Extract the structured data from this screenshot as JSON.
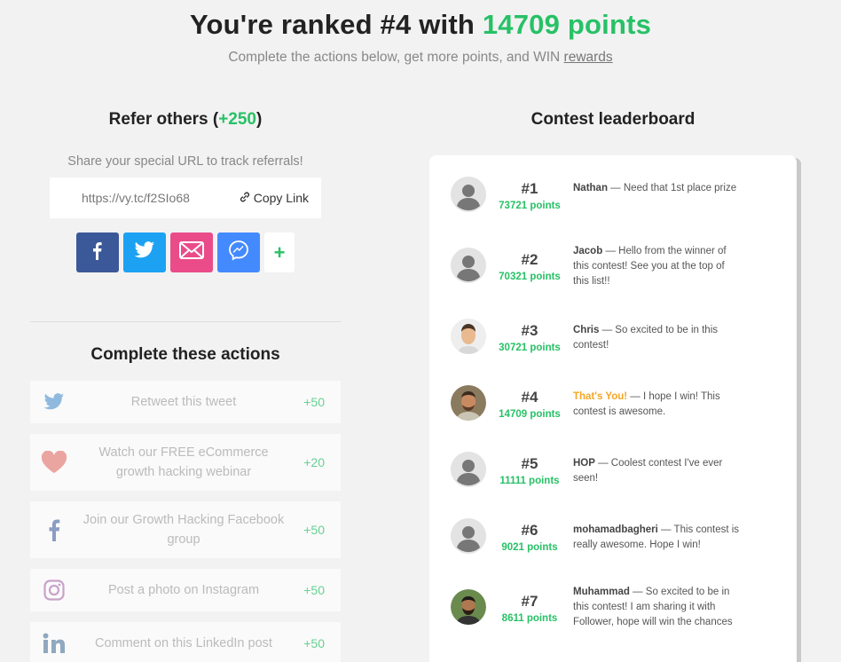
{
  "hero": {
    "title_prefix": "You're ranked #4 with ",
    "title_points": "14709 points",
    "subtitle_prefix": "Complete the actions below, get more points, and WIN ",
    "subtitle_link": "rewards"
  },
  "refer": {
    "title": "Refer others (",
    "bonus": "+250",
    "title_suffix": ")",
    "share_text": "Share your special URL to track referrals!",
    "url": "https://vy.tc/f2SIo68",
    "copy_label": "Copy Link",
    "share_buttons": [
      {
        "name": "facebook",
        "color": "#3b5998",
        "icon": "facebook-icon"
      },
      {
        "name": "twitter",
        "color": "#1da1f2",
        "icon": "twitter-icon"
      },
      {
        "name": "email",
        "color": "#ea4c89",
        "icon": "mail-icon"
      },
      {
        "name": "messenger",
        "color": "#448aff",
        "icon": "messenger-icon"
      }
    ],
    "more_label": "+"
  },
  "actions": {
    "title": "Complete these actions",
    "items": [
      {
        "label": "Retweet this tweet",
        "points": "+50",
        "icon": "twitter-icon"
      },
      {
        "label": "Watch our FREE eCommerce growth hacking webinar",
        "points": "+20",
        "icon": "heart-icon"
      },
      {
        "label": "Join our Growth Hacking Facebook group",
        "points": "+50",
        "icon": "facebook-icon"
      },
      {
        "label": "Post a photo on Instagram",
        "points": "+50",
        "icon": "instagram-icon"
      },
      {
        "label": "Comment on this LinkedIn post",
        "points": "+50",
        "icon": "linkedin-icon"
      }
    ]
  },
  "leaderboard": {
    "title": "Contest leaderboard",
    "entries": [
      {
        "rank": "#1",
        "points": "73721 points",
        "name": "Nathan",
        "comment": " — Need that 1st place prize",
        "avatar": "default"
      },
      {
        "rank": "#2",
        "points": "70321 points",
        "name": "Jacob",
        "comment": " — Hello from the winner of this contest! See you at the top of this list!!",
        "avatar": "default"
      },
      {
        "rank": "#3",
        "points": "30721 points",
        "name": "Chris",
        "comment": " — So excited to be in this contest!",
        "avatar": "photo"
      },
      {
        "rank": "#4",
        "points": "14709 points",
        "name": "That's You!",
        "comment": " — I hope I win! This contest is awesome.",
        "avatar": "photo",
        "is_you": true
      },
      {
        "rank": "#5",
        "points": "11111 points",
        "name": "HOP",
        "comment": " — Coolest contest I've ever seen!",
        "avatar": "default"
      },
      {
        "rank": "#6",
        "points": "9021 points",
        "name": "mohamadbagheri",
        "comment": " — This contest is really awesome. Hope I win!",
        "avatar": "default"
      },
      {
        "rank": "#7",
        "points": "8611 points",
        "name": "Muhammad",
        "comment": " — So excited to be in this contest! I am sharing it with Follower, hope will win the chances",
        "avatar": "photo"
      }
    ]
  },
  "colors": {
    "accent": "#27c166",
    "you": "#f5a623"
  }
}
